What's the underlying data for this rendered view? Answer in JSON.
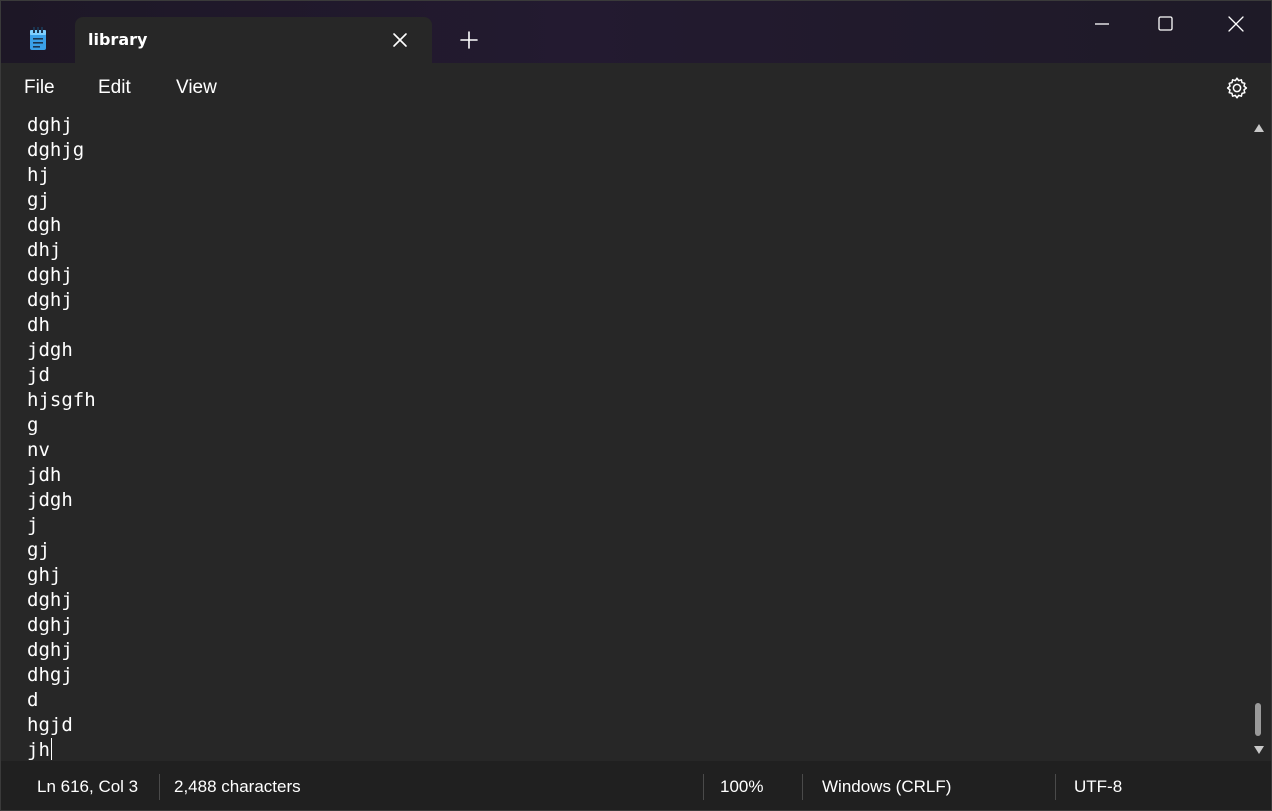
{
  "window": {
    "tab_title": "library",
    "icons": {
      "app": "notepad-icon",
      "tab_close": "close-icon",
      "new_tab": "plus-icon",
      "minimize": "minimize-icon",
      "maximize": "maximize-icon",
      "close": "close-icon",
      "settings": "gear-icon"
    }
  },
  "menu": {
    "file": "File",
    "edit": "Edit",
    "view": "View"
  },
  "editor": {
    "lines": [
      "dghj",
      "dghjg",
      "hj",
      "gj",
      "dgh",
      "dhj",
      "dghj",
      "dghj",
      "dh",
      "jdgh",
      "jd",
      "hjsgfh",
      "g",
      "nv",
      "jdh",
      "jdgh",
      "j",
      "gj",
      "ghj",
      "dghj",
      "dghj",
      "dghj",
      "dhgj",
      "d",
      "hgjd",
      "jh"
    ]
  },
  "status": {
    "position": "Ln 616, Col 3",
    "characters": "2,488 characters",
    "zoom": "100%",
    "line_ending": "Windows (CRLF)",
    "encoding": "UTF-8"
  },
  "colors": {
    "titlebar": "#231a30",
    "editor_bg": "#272727",
    "status_bg": "#202020",
    "text": "#ffffff",
    "icon_blue": "#3aa0e8"
  }
}
